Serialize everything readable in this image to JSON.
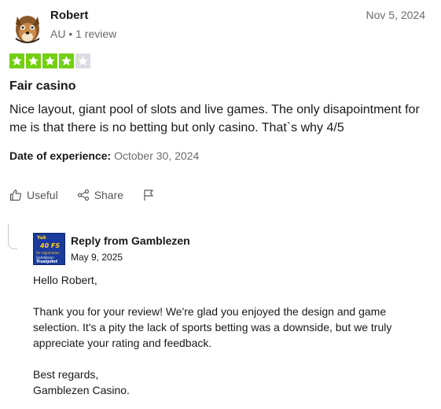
{
  "reviewer": {
    "name": "Robert",
    "meta": "AU • 1 review",
    "avatar_icon": "fox-avatar-icon"
  },
  "review": {
    "date": "Nov 5, 2024",
    "rating": 4,
    "rating_max": 5,
    "star_colors": {
      "filled": "#73cf11",
      "empty": "#dcdce6"
    },
    "title": "Fair casino",
    "body": "Nice layout, giant pool of slots and live games. The only disapointment for me is that there is no betting but only casino. That`s why 4/5",
    "experience_label": "Date of experience:",
    "experience_value": "October 30, 2024"
  },
  "actions": {
    "useful_label": "Useful",
    "share_label": "Share",
    "useful_icon": "thumbs-up-icon",
    "share_icon": "share-icon",
    "flag_icon": "flag-icon"
  },
  "reply": {
    "logo": {
      "line1": "Yak",
      "line2": "40 FS",
      "line3": "for registration",
      "line4": "Gamblezen",
      "line5": "Trustpilot"
    },
    "from": "Reply from Gamblezen",
    "date": "May 9, 2025",
    "paragraphs": [
      "Hello Robert,",
      "Thank you for your review! We're glad you enjoyed the design and game selection. It's a pity the lack of sports betting was a downside, but we truly appreciate your rating and feedback.",
      "Best regards,\nGamblezen Casino."
    ]
  }
}
